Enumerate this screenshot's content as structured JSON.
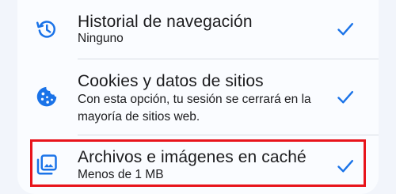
{
  "settings_list": {
    "items": [
      {
        "title": "Historial de navegación",
        "subtitle": "Ninguno",
        "icon": "history-icon",
        "checked": true
      },
      {
        "title": "Cookies y datos de sitios",
        "subtitle": "Con esta opción, tu sesión se cerrará en la mayoría de sitios web.",
        "icon": "cookie-icon",
        "checked": true
      },
      {
        "title": "Archivos e imágenes en caché",
        "subtitle": "Menos de 1 MB",
        "icon": "image-cache-icon",
        "checked": true
      }
    ]
  },
  "colors": {
    "accent": "#1a73e8",
    "highlight_border": "#e8141b",
    "background": "#f2f5fb",
    "card": "#fafcff"
  }
}
